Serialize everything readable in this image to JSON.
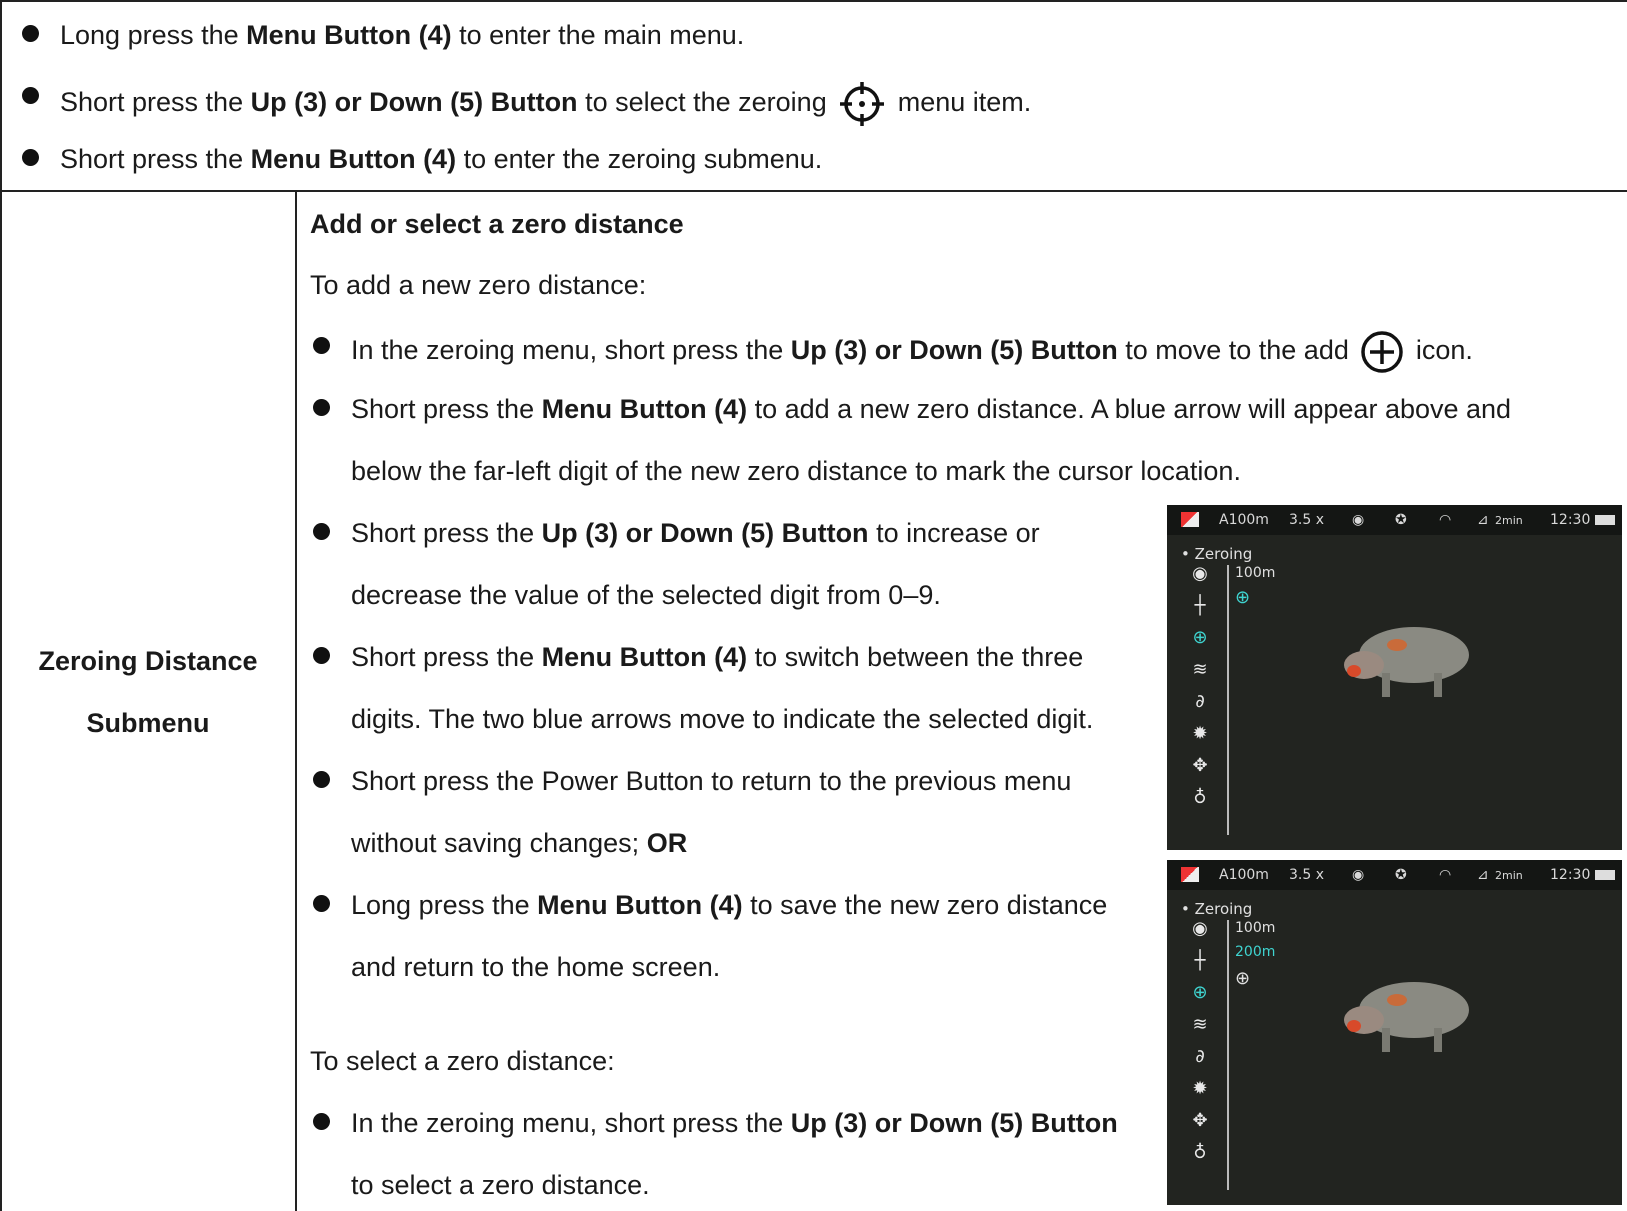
{
  "top_bullets": [
    {
      "pre": "Long press the ",
      "bold": "Menu Button (4)",
      "post": " to enter the main menu."
    },
    {
      "pre": "Short press the ",
      "bold": "Up (3) or Down (5) Button",
      "mid": " to select the zeroing ",
      "icon": "zeroing-crosshair-icon",
      "post": " menu item."
    },
    {
      "pre": "Short press the ",
      "bold": "Menu Button (4)",
      "post": " to enter the zeroing submenu."
    }
  ],
  "row_label": {
    "line1": "Zeroing Distance",
    "line2": "Submenu"
  },
  "section": {
    "heading": "Add or select a zero distance",
    "add_intro": "To add a new zero distance:",
    "add_bullets": [
      {
        "pre": "In the zeroing menu, short press the ",
        "bold": "Up (3) or Down (5) Button",
        "post": " to move to the add ",
        "icon": "add-circle-icon",
        "post2": " icon."
      },
      {
        "pre": "Short press the ",
        "bold": "Menu Button (4)",
        "post": " to add a new zero distance. A blue arrow will appear above and",
        "line2": "below the far-left digit of the new zero distance to mark the cursor location."
      },
      {
        "pre": "Short press the ",
        "bold": "Up (3) or Down (5) Button",
        "post": " to increase or",
        "line2": "decrease the value of the selected digit from 0–9."
      },
      {
        "pre": "Short press the ",
        "bold": "Menu Button (4)",
        "post": " to switch between the three",
        "line2": "digits. The two blue arrows move to indicate the selected digit."
      },
      {
        "pre": "Short press the Power Button to return to the previous menu",
        "line2_pre": "without saving changes; ",
        "line2_bold": "OR"
      },
      {
        "pre": "Long press the ",
        "bold": "Menu Button (4)",
        "post": " to save the new zero distance",
        "line2": "and return to the home screen."
      }
    ],
    "select_intro": "To select a zero distance:",
    "select_bullets": [
      {
        "pre": "In the zeroing menu, short press the ",
        "bold": "Up (3) or Down (5) Button",
        "line2": "to select a zero distance."
      }
    ]
  },
  "screens": [
    {
      "status": {
        "range": "A100m",
        "zoom": "3.5 x",
        "timer": "2min",
        "time": "12:30"
      },
      "menu_title": "• Zeroing",
      "distances": [
        "100m"
      ],
      "selected_distance": ""
    },
    {
      "status": {
        "range": "A100m",
        "zoom": "3.5 x",
        "timer": "2min",
        "time": "12:30"
      },
      "menu_title": "• Zeroing",
      "distances": [
        "100m"
      ],
      "selected_distance": "200m"
    }
  ]
}
